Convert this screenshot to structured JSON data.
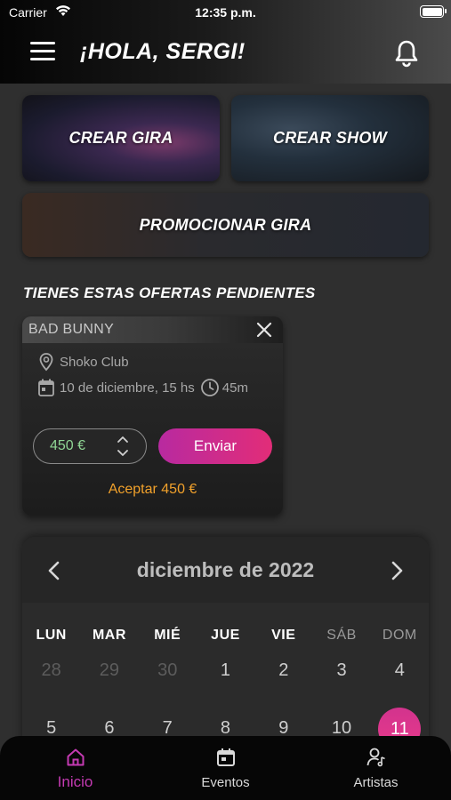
{
  "status_bar": {
    "carrier": "Carrier",
    "time": "12:35 p.m."
  },
  "header": {
    "greeting": "¡HOLA, SERGI!"
  },
  "actions": {
    "create_tour": "CREAR GIRA",
    "create_show": "CREAR SHOW",
    "promote_tour": "PROMOCIONAR GIRA"
  },
  "offers": {
    "title": "TIENES ESTAS OFERTAS PENDIENTES",
    "items": [
      {
        "artist": "BAD BUNNY",
        "venue": "Shoko Club",
        "date": "10 de diciembre, 15 hs",
        "duration": "45m",
        "price": "450 €",
        "send_label": "Enviar",
        "accept_label": "Aceptar 450 €"
      }
    ]
  },
  "calendar": {
    "month": "diciembre de 2022",
    "weekdays": [
      "LUN",
      "MAR",
      "MIÉ",
      "JUE",
      "VIE",
      "SÁB",
      "DOM"
    ],
    "week1": [
      "28",
      "29",
      "30",
      "1",
      "2",
      "3",
      "4"
    ],
    "week2": [
      "5",
      "6",
      "7",
      "8",
      "9",
      "10",
      "11"
    ],
    "selected_day": "11"
  },
  "tabbar": {
    "items": [
      {
        "label": "Inicio",
        "icon": "home-icon",
        "active": true
      },
      {
        "label": "Eventos",
        "icon": "calendar-icon",
        "active": false
      },
      {
        "label": "Artistas",
        "icon": "artist-icon",
        "active": false
      }
    ]
  },
  "colors": {
    "accent_magenta": "#c43ab2",
    "button_gradient_start": "#b82aa0",
    "button_gradient_end": "#e22d78",
    "accept_orange": "#f1a12b",
    "price_green": "#8fd694"
  }
}
